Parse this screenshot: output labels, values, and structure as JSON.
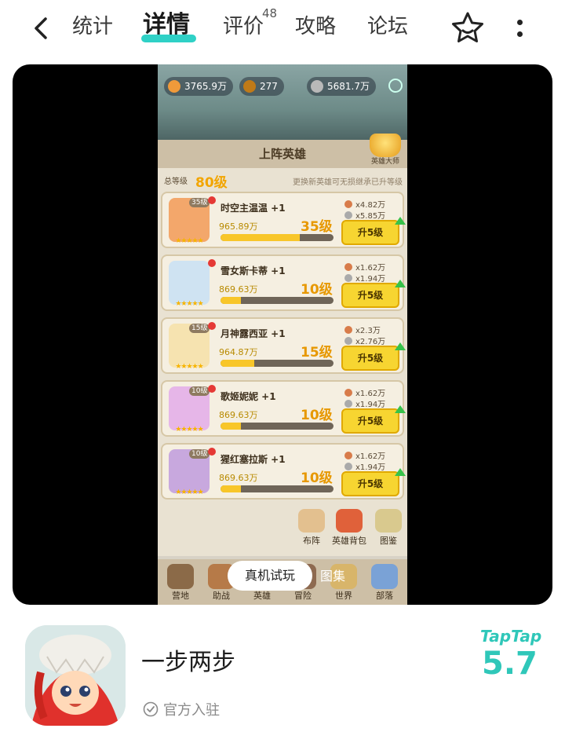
{
  "nav": {
    "tabs": [
      {
        "label": "统计"
      },
      {
        "label": "详情",
        "active": true
      },
      {
        "label": "评价",
        "badge": "48"
      },
      {
        "label": "攻略"
      },
      {
        "label": "论坛"
      }
    ],
    "icons": [
      "back-icon",
      "star-icon",
      "more-icon"
    ]
  },
  "game": {
    "resources": [
      {
        "value": "3765.9万",
        "icon": "gold-bar-icon"
      },
      {
        "value": "277",
        "icon": "bird-icon"
      },
      {
        "value": "5681.7万",
        "icon": "coin-icon"
      }
    ],
    "panel_title": "上阵英雄",
    "master_label": "英雄大师",
    "total_level_label": "总等级",
    "total_level_value": "80级",
    "tip": "更换新英雄可无损继承已升等级",
    "heroes": [
      {
        "name": "时空主温温 +1",
        "cost": "965.89万",
        "level": "35级",
        "tag": "35级",
        "mult1": "x4.82万",
        "mult2": "x5.85万",
        "button": "升5级",
        "progress": 0.7
      },
      {
        "name": "雪女斯卡蒂 +1",
        "cost": "869.63万",
        "level": "10级",
        "tag": "",
        "mult1": "x1.62万",
        "mult2": "x1.94万",
        "button": "升5级",
        "progress": 0.18
      },
      {
        "name": "月神露西亚 +1",
        "cost": "964.87万",
        "level": "15级",
        "tag": "15级",
        "mult1": "x2.3万",
        "mult2": "x2.76万",
        "button": "升5级",
        "progress": 0.3
      },
      {
        "name": "歌姬妮妮 +1",
        "cost": "869.63万",
        "level": "10级",
        "tag": "10级",
        "mult1": "x1.62万",
        "mult2": "x1.94万",
        "button": "升5级",
        "progress": 0.18
      },
      {
        "name": "猩红塞拉斯 +1",
        "cost": "869.63万",
        "level": "10级",
        "tag": "10级",
        "mult1": "x1.62万",
        "mult2": "x1.94万",
        "button": "升5级",
        "progress": 0.18
      }
    ],
    "quick_buttons": [
      "布阵",
      "英雄背包",
      "图鉴"
    ],
    "dock": [
      "营地",
      "助战",
      "英雄",
      "冒险",
      "世界",
      "部落"
    ]
  },
  "media": {
    "trial_label": "真机试玩",
    "gallery_label": "图集"
  },
  "app": {
    "name": "一步两步",
    "official_label": "官方入驻",
    "brand": "TapTap",
    "score": "5.7"
  },
  "colors": {
    "accent": "#2fc7b9",
    "tab_underline": "#2fd1c6",
    "upgrade_button": "#f7d531"
  }
}
